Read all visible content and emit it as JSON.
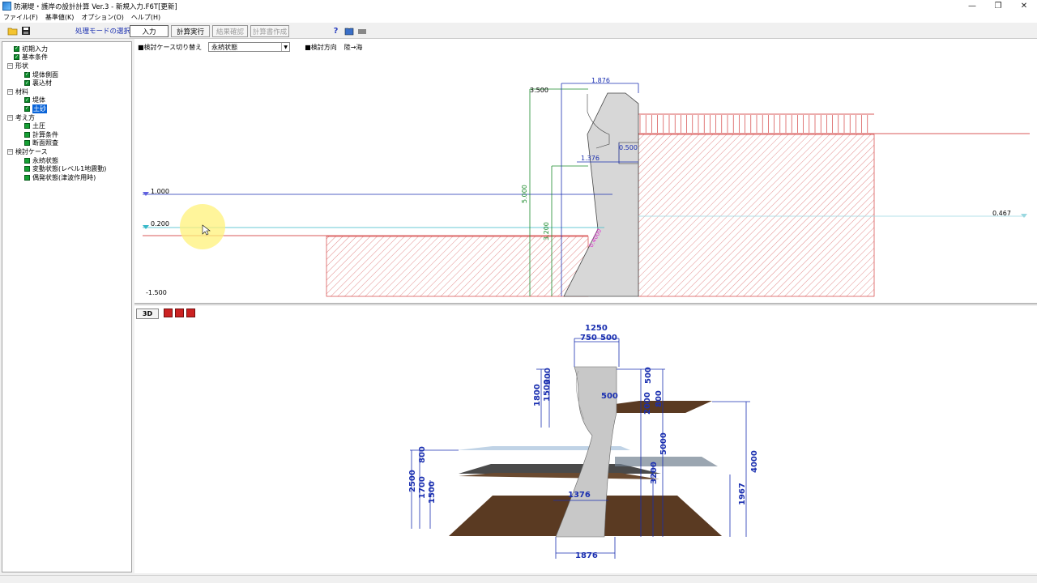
{
  "window": {
    "title": "防潮堤・護岸の設計計算 Ver.3 - 新規入力.F6T[更新]",
    "buttons": {
      "minimize": "—",
      "restore": "❐",
      "close": "✕"
    }
  },
  "menu": [
    {
      "label": "ファイル(F)"
    },
    {
      "label": "基準値(K)"
    },
    {
      "label": "オプション(O)"
    },
    {
      "label": "ヘルプ(H)"
    }
  ],
  "toolbar": {
    "mode_label": "処理モードの選択",
    "input": "入力",
    "calc": "計算実行",
    "result": "結果確認",
    "report": "計算書作成"
  },
  "tree": [
    {
      "label": "初期入力",
      "level": 1,
      "check": true
    },
    {
      "label": "基本条件",
      "level": 1,
      "check": true
    },
    {
      "label": "形状",
      "level": 0,
      "expand": true
    },
    {
      "label": "堤体側面",
      "level": 2,
      "check": true
    },
    {
      "label": "裏込材",
      "level": 2,
      "check": true
    },
    {
      "label": "材料",
      "level": 0,
      "expand": true
    },
    {
      "label": "堤体",
      "level": 2,
      "check": true
    },
    {
      "label": "土砂",
      "level": 2,
      "check": true,
      "selected": true
    },
    {
      "label": "考え方",
      "level": 0,
      "expand": true
    },
    {
      "label": "土圧",
      "level": 2,
      "check": true,
      "plain": true
    },
    {
      "label": "計算条件",
      "level": 2,
      "check": true,
      "plain": true
    },
    {
      "label": "断面照査",
      "level": 2,
      "check": true,
      "plain": true
    },
    {
      "label": "検討ケース",
      "level": 0,
      "expand": true
    },
    {
      "label": "永続状態",
      "level": 2,
      "check": true,
      "plain": true
    },
    {
      "label": "変動状態(レベル1地震動)",
      "level": 2,
      "check": true,
      "plain": true
    },
    {
      "label": "偶発状態(津波作用時)",
      "level": 2,
      "check": true,
      "plain": true
    }
  ],
  "case": {
    "label": "■検討ケース切り替え",
    "value": "永続状態",
    "direction_label": "■検討方向",
    "direction_value": "陸→海"
  },
  "section": {
    "dims": {
      "d3500": "3.500",
      "d1876": "1.876",
      "d0500": "0.500",
      "d1376": "1.376",
      "d5000": "5.000",
      "d3200": "3.200",
      "wl1000": "1.000",
      "wl0200": "0.200",
      "wlm1500": "-1.500",
      "wl0467": "0.467",
      "slope": "0.4000"
    },
    "colors": {
      "green": "#1a8a2a",
      "blue": "#1a2fb0",
      "red": "#cc2222",
      "magenta": "#e030d0",
      "cyan": "#38b8c8"
    }
  },
  "view3d": {
    "button": "3D",
    "dims": {
      "t1250": "1250",
      "t750": "750",
      "t500": "500",
      "l300": "300",
      "l1800": "1800",
      "l1500": "1500",
      "r500": "500",
      "r500b": "500",
      "r800": "800",
      "r2000": "2000",
      "r5000": "5000",
      "r3200": "3200",
      "r4000": "4000",
      "r1967": "1967",
      "l800": "800",
      "l2500": "2500",
      "l1700": "1700",
      "l1500b": "1500",
      "m1376": "1376",
      "b1876": "1876"
    }
  }
}
